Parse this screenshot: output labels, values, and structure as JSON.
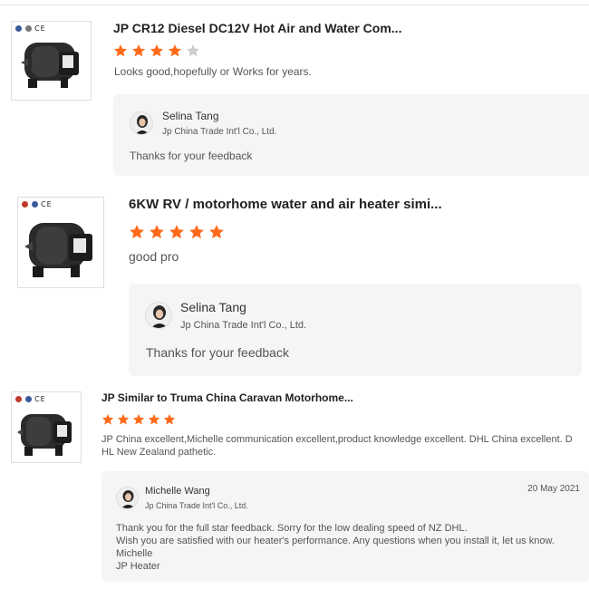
{
  "colors": {
    "star_on": "#ff6a1a",
    "star_off": "#cccccc",
    "reply_bg": "#f5f5f6"
  },
  "reviews": [
    {
      "cert_text": "CE",
      "title": "JP CR12 Diesel DC12V Hot Air and Water Com...",
      "rating": 4,
      "max_rating": 5,
      "comment": "Looks good,hopefully or Works for years.",
      "reply": {
        "name": "Selina Tang",
        "company": "Jp China Trade Int'l Co., Ltd.",
        "date": "",
        "lines": [
          "Thanks for your feedback"
        ]
      }
    },
    {
      "cert_text": "CE",
      "title": "6KW RV / motorhome water and air heater simi...",
      "rating": 5,
      "max_rating": 5,
      "comment": "good pro",
      "reply": {
        "name": "Selina Tang",
        "company": "Jp China Trade Int'l Co., Ltd.",
        "date": "",
        "lines": [
          "Thanks for your feedback"
        ]
      }
    },
    {
      "cert_text": "CE",
      "title": "JP Similar to Truma China Caravan Motorhome...",
      "rating": 5,
      "max_rating": 5,
      "comment_lines": [
        "JP China excellent,Michelle communication excellent,product knowledge excellent. DHL  China excellent. D",
        "HL New Zealand pathetic."
      ],
      "reply": {
        "name": "Michelle Wang",
        "company": "Jp China Trade Int'l Co., Ltd.",
        "date": "20 May 2021",
        "lines": [
          "Thank you for the full star feedback. Sorry for the low dealing speed of NZ DHL.",
          "Wish you are satisfied with our heater's performance. Any questions when you install it, let us know.",
          "Michelle",
          "JP Heater"
        ]
      }
    }
  ]
}
